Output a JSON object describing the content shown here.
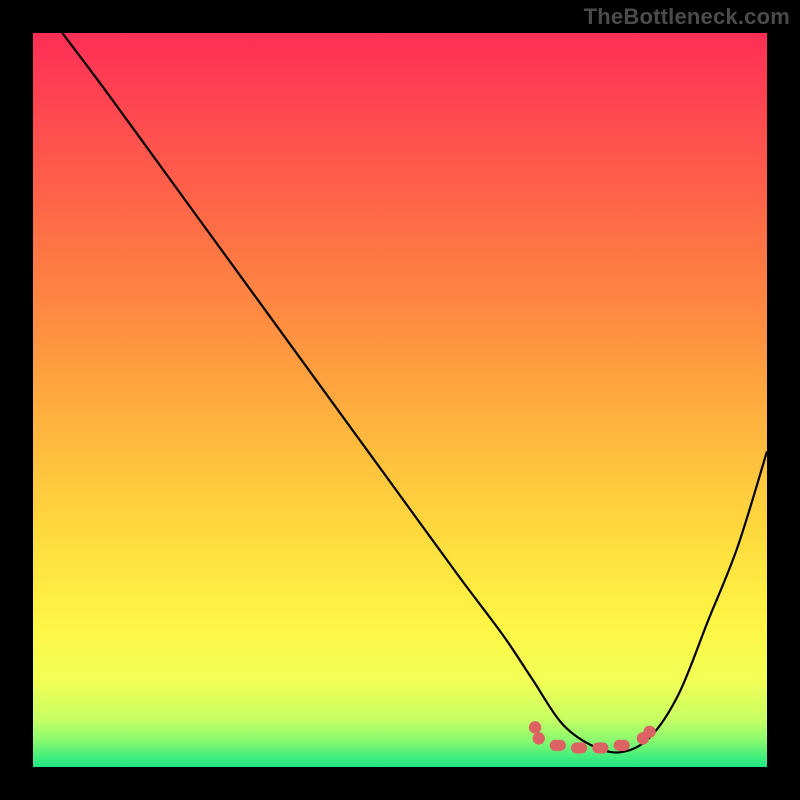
{
  "branding": {
    "watermark": "TheBottleneck.com"
  },
  "colors": {
    "background": "#000000",
    "curve": "#000000",
    "markers": "#dd6263",
    "gradient_stops": [
      {
        "offset": 0.0,
        "color": "#ff2e57"
      },
      {
        "offset": 0.12,
        "color": "#ff4b4f"
      },
      {
        "offset": 0.27,
        "color": "#ff6f46"
      },
      {
        "offset": 0.42,
        "color": "#ff9440"
      },
      {
        "offset": 0.55,
        "color": "#ffb83d"
      },
      {
        "offset": 0.68,
        "color": "#ffda3d"
      },
      {
        "offset": 0.8,
        "color": "#fff545"
      },
      {
        "offset": 0.88,
        "color": "#f4ff55"
      },
      {
        "offset": 0.935,
        "color": "#c7ff63"
      },
      {
        "offset": 0.965,
        "color": "#86f96f"
      },
      {
        "offset": 0.985,
        "color": "#46ee7c"
      },
      {
        "offset": 1.0,
        "color": "#1fe884"
      }
    ]
  },
  "chart_data": {
    "type": "line",
    "title": "",
    "xlabel": "",
    "ylabel": "",
    "xlim": [
      0,
      100
    ],
    "ylim": [
      0,
      100
    ],
    "grid": false,
    "notes": "V-shaped curve. Left branch descends from upper-left to a broad minimum near x≈74–82 (y≈2–3), then rises toward upper-right. Background is a vertical red→green gradient. Salmon dots and short horizontal pill markers sit along the valley floor.",
    "series": [
      {
        "name": "curve",
        "x": [
          4,
          10,
          18,
          26,
          34,
          42,
          50,
          58,
          64,
          68,
          72,
          76,
          80,
          84,
          88,
          92,
          96,
          100
        ],
        "y": [
          100,
          92,
          81,
          70,
          59,
          48,
          37,
          26,
          18,
          12,
          6,
          3,
          2,
          4,
          10,
          20,
          30,
          43
        ]
      }
    ],
    "markers": {
      "dots": [
        {
          "x": 68.4,
          "y": 5.4
        },
        {
          "x": 68.9,
          "y": 3.9
        },
        {
          "x": 83.1,
          "y": 3.9
        },
        {
          "x": 84.0,
          "y": 4.8
        }
      ],
      "pills": [
        {
          "x0": 70.4,
          "x1": 72.6,
          "y": 2.95
        },
        {
          "x0": 73.3,
          "x1": 75.5,
          "y": 2.6
        },
        {
          "x0": 76.2,
          "x1": 78.4,
          "y": 2.6
        },
        {
          "x0": 79.1,
          "x1": 81.3,
          "y": 2.95
        }
      ]
    }
  }
}
